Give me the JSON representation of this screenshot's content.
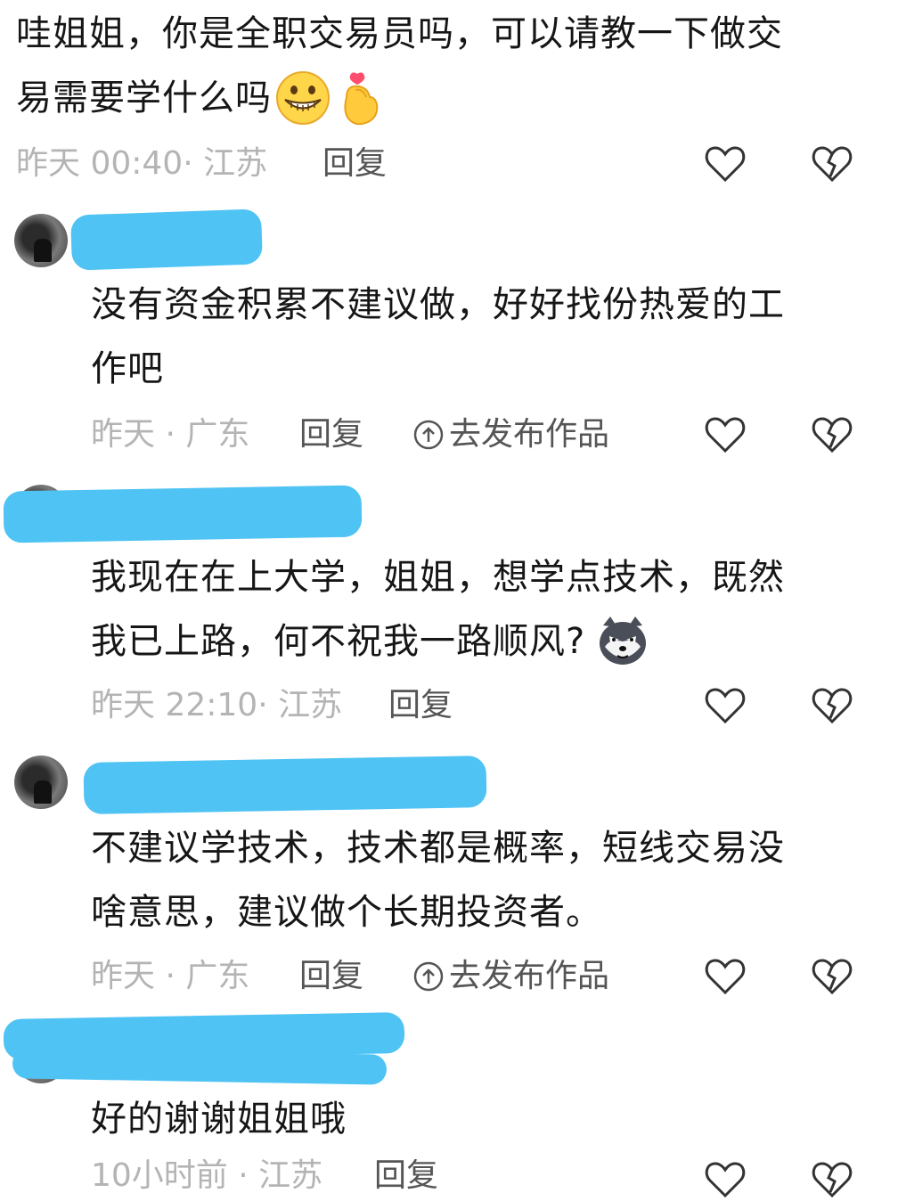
{
  "comments": [
    {
      "text_lines": [
        "哇姐姐，你是全职交易员吗，可以请教一下做交",
        "易需要学什么吗"
      ],
      "meta": "昨天 00:40· 江苏",
      "reply_label": "回复"
    },
    {
      "text_lines": [
        "没有资金积累不建议做，好好找份热爱的工",
        "作吧"
      ],
      "meta": "昨天 · 广东",
      "reply_label": "回复",
      "publish_label": "去发布作品"
    },
    {
      "text_lines": [
        "我现在在上大学，姐姐，想学点技术，既然",
        "我已上路，何不祝我一路顺风?"
      ],
      "meta": "昨天 22:10· 江苏",
      "reply_label": "回复"
    },
    {
      "text_lines": [
        "不建议学技术，技术都是概率，短线交易没",
        "啥意思，建议做个长期投资者。"
      ],
      "meta": "昨天 · 广东",
      "reply_label": "回复",
      "publish_label": "去发布作品"
    },
    {
      "text_lines": [
        "好的谢谢姐姐哦"
      ],
      "meta": "10小时前 · 江苏",
      "reply_label": "回复"
    }
  ],
  "colors": {
    "text": "#161616",
    "meta": "#b4b4b4",
    "action": "#555555",
    "redaction": "#4fc3f3"
  },
  "icons": {
    "like": "heart-outline-icon",
    "dislike": "broken-heart-icon",
    "publish": "upload-circle-icon"
  }
}
